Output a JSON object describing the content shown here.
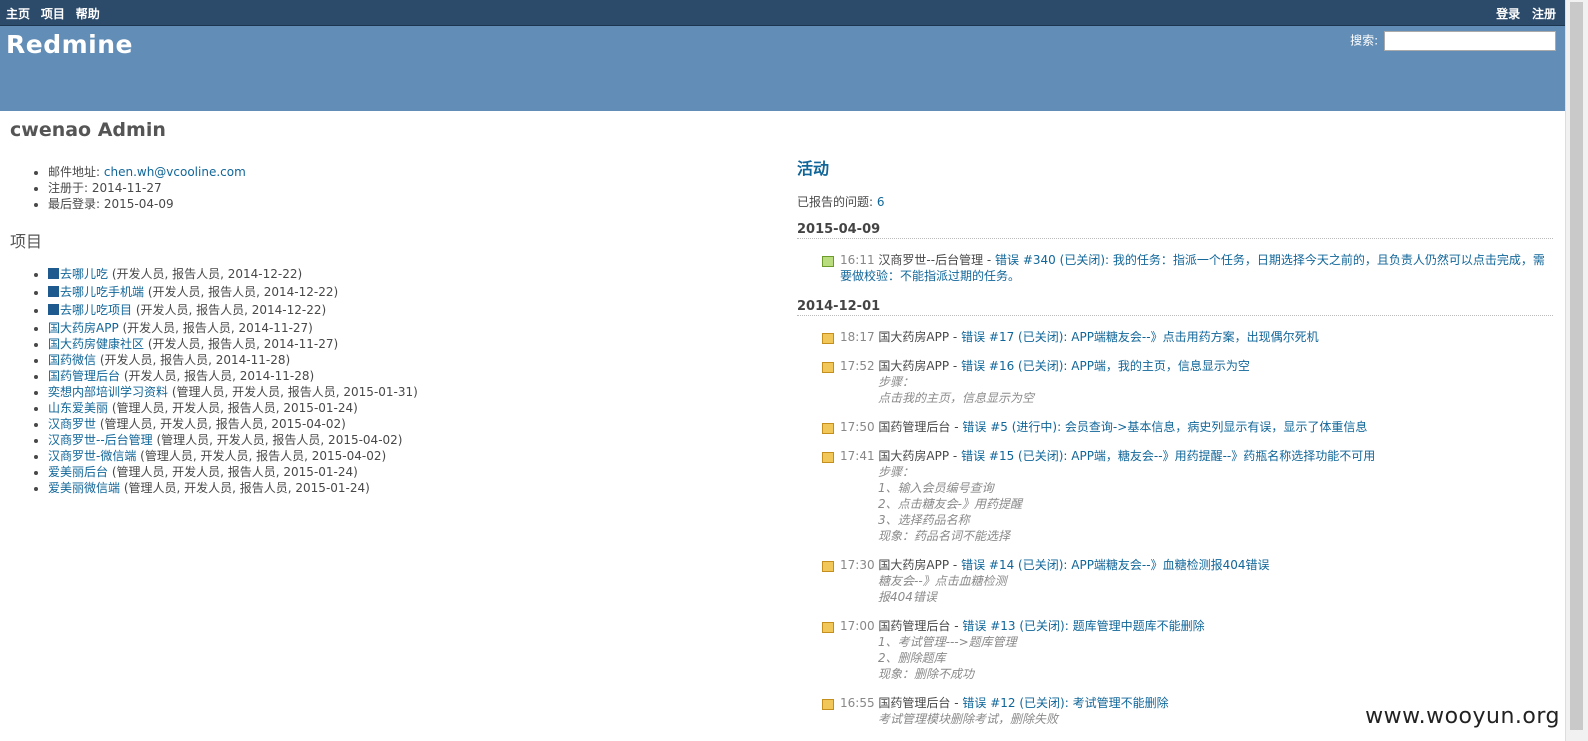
{
  "top_menu": {
    "left": [
      "主页",
      "项目",
      "帮助"
    ],
    "right": [
      "登录",
      "注册"
    ]
  },
  "header": {
    "title": "Redmine",
    "search_label": "搜索:"
  },
  "user": {
    "name": "cwenao Admin",
    "email_label": "邮件地址:",
    "email": "chen.wh@vcooline.com",
    "registered_label": "注册于:",
    "registered": "2014-11-27",
    "last_login_label": "最后登录:",
    "last_login": "2015-04-09"
  },
  "projects_title": "项目",
  "projects": [
    {
      "name": "去哪儿吃",
      "roles": " (开发人员, 报告人员, 2014-12-22)"
    },
    {
      "name": "去哪儿吃手机端",
      "roles": " (开发人员, 报告人员, 2014-12-22)"
    },
    {
      "name": "去哪儿吃项目",
      "roles": " (开发人员, 报告人员, 2014-12-22)"
    },
    {
      "name": "国大药房APP",
      "roles": " (开发人员, 报告人员, 2014-11-27)"
    },
    {
      "name": "国大药房健康社区",
      "roles": " (开发人员, 报告人员, 2014-11-27)"
    },
    {
      "name": "国药微信",
      "roles": " (开发人员, 报告人员, 2014-11-28)"
    },
    {
      "name": "国药管理后台",
      "roles": " (开发人员, 报告人员, 2014-11-28)"
    },
    {
      "name": "奕想内部培训学习资料",
      "roles": " (管理人员, 开发人员, 报告人员, 2015-01-31)"
    },
    {
      "name": "山东爱美丽",
      "roles": " (管理人员, 开发人员, 报告人员, 2015-01-24)"
    },
    {
      "name": "汉商罗世",
      "roles": " (管理人员, 开发人员, 报告人员, 2015-04-02)"
    },
    {
      "name": "汉商罗世--后台管理",
      "roles": " (管理人员, 开发人员, 报告人员, 2015-04-02)"
    },
    {
      "name": "汉商罗世-微信端",
      "roles": " (管理人员, 开发人员, 报告人员, 2015-04-02)"
    },
    {
      "name": "爱美丽后台",
      "roles": " (管理人员, 开发人员, 报告人员, 2015-01-24)"
    },
    {
      "name": "爱美丽微信端",
      "roles": " (管理人员, 开发人员, 报告人员, 2015-01-24)"
    }
  ],
  "activity": {
    "title": "活动",
    "reported_label": "已报告的问题:",
    "reported_count": "6",
    "days": [
      {
        "date": "2015-04-09",
        "events": [
          {
            "time": "16:11",
            "project": "汉商罗世--后台管理 - ",
            "link": "错误 #340 (已关闭): 我的任务：指派一个任务，日期选择今天之前的，且负责人仍然可以点击完成，需要做校验：不能指派过期的任务。",
            "desc": []
          }
        ]
      },
      {
        "date": "2014-12-01",
        "events": [
          {
            "time": "18:17",
            "project": "国大药房APP - ",
            "link": "错误 #17 (已关闭): APP端糖友会--》点击用药方案，出现偶尔死机",
            "desc": []
          },
          {
            "time": "17:52",
            "project": "国大药房APP - ",
            "link": "错误 #16 (已关闭): APP端，我的主页，信息显示为空",
            "desc": [
              "步骤：",
              "点击我的主页，信息显示为空"
            ]
          },
          {
            "time": "17:50",
            "project": "国药管理后台 - ",
            "link": "错误 #5 (进行中): 会员查询->基本信息，病史列显示有误，显示了体重信息",
            "desc": []
          },
          {
            "time": "17:41",
            "project": "国大药房APP - ",
            "link": "错误 #15 (已关闭): APP端，糖友会--》用药提醒--》药瓶名称选择功能不可用",
            "desc": [
              "步骤：",
              "1、输入会员编号查询",
              "2、点击糖友会-》用药提醒",
              "3、选择药品名称",
              "现象：药品名词不能选择"
            ]
          },
          {
            "time": "17:30",
            "project": "国大药房APP - ",
            "link": "错误 #14 (已关闭): APP端糖友会--》血糖检测报404错误",
            "desc": [
              "糖友会--》点击血糖检测",
              "报404错误"
            ]
          },
          {
            "time": "17:00",
            "project": "国药管理后台 - ",
            "link": "错误 #13 (已关闭): 题库管理中题库不能删除",
            "desc": [
              "1、考试管理--->题库管理",
              "2、删除题库",
              "现象：删除不成功"
            ]
          },
          {
            "time": "16:55",
            "project": "国药管理后台 - ",
            "link": "错误 #12 (已关闭): 考试管理不能删除",
            "desc": [
              "考试管理模块删除考试，删除失败"
            ]
          }
        ]
      }
    ]
  },
  "watermark": "www.wooyun.org"
}
